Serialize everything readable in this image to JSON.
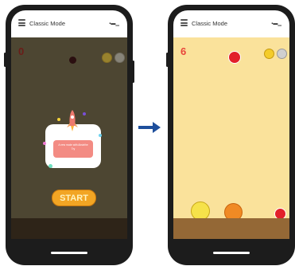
{
  "app": {
    "title": "Classic Mode",
    "status_right": "▪▬▁"
  },
  "before": {
    "score": "0",
    "popup_text_line1": "A new mode with Absinthe",
    "popup_text_line2": "Try",
    "start_label": "START"
  },
  "after": {
    "score": "6"
  },
  "colors": {
    "accent_start": "#f2a524",
    "score_red": "#e8453b",
    "playfield_dim": "#4d4632",
    "playfield_bright": "#fae29b",
    "ground": "#946836"
  },
  "icons": [
    "menu-icon",
    "signal-icon",
    "gold-coin-icon",
    "silver-coin-icon",
    "rocket-icon",
    "arrow-right-icon"
  ]
}
